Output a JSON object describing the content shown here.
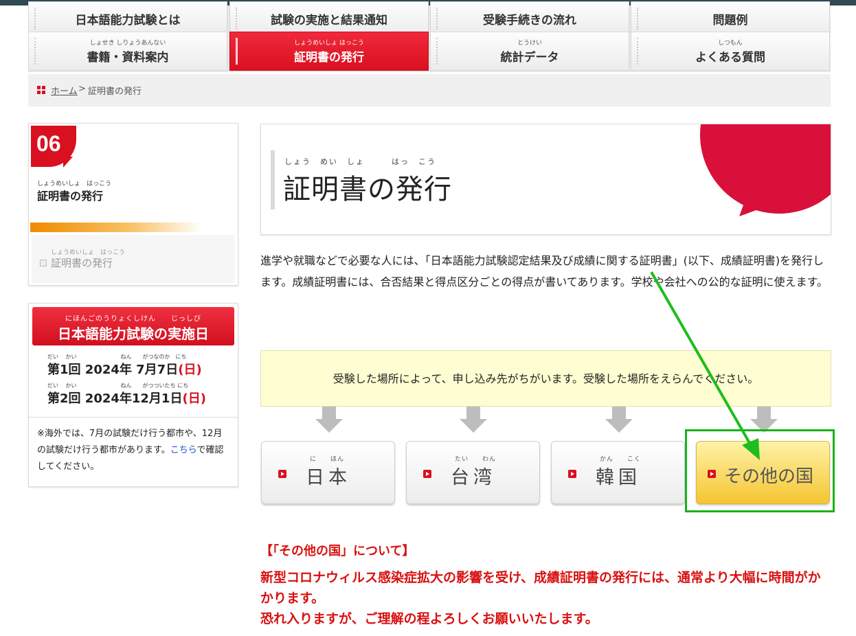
{
  "nav": {
    "row1": [
      {
        "label": "日本語能力試験とは"
      },
      {
        "label": "試験の実施と結果通知"
      },
      {
        "label": "受験手続きの流れ"
      },
      {
        "label": "問題例"
      }
    ],
    "row2": [
      {
        "ruby": "しょせき しりょうあんない",
        "label": "書籍・資料案内"
      },
      {
        "ruby": "しょうめいしょ はっこう",
        "label": "証明書の発行"
      },
      {
        "ruby": "とうけい",
        "label": "統計データ"
      },
      {
        "ruby": "しつもん",
        "label": "よくある質問"
      }
    ]
  },
  "breadcrumb": {
    "home": "ホーム",
    "separator": " > ",
    "current": "証明書の発行"
  },
  "sidebar": {
    "number": "06",
    "ruby": "しょうめいしょ　はっこう",
    "title": "証明書の発行",
    "sub_ruby": "しょうめいしょ　はっこう",
    "sub_link": "証明書の発行"
  },
  "schedule": {
    "ruby": "にほんごのうりょくしけん　　じっしび",
    "title": "日本語能力試験の実施日",
    "row1_ruby": "だい　 かい　　　　　　　　ねん　　がつなのか　にち",
    "row1": "第1回 2024年 7月7日",
    "row1_day": "(日)",
    "row2_ruby": "だい　 かい　　　　　　　　ねん　　がつついたち にち",
    "row2": "第2回 2024年12月1日",
    "row2_day": "(日)",
    "note_a": "※海外では、7月の試験だけ行う都市や、12月の試験だけ行う都市があります。",
    "note_link": "こちら",
    "note_b": "で確認してください。"
  },
  "page": {
    "title_ruby": "しょう　めい　しょ　　　はっ　こう",
    "title": "証明書の発行",
    "intro": "進学や就職などで必要な人には、「日本語能力試験認定結果及び成績に関する証明書」(以下、成績証明書)を発行します。成績証明書には、合否結果と得点区分ごとの得点が書いてあります。学校や会社への公的な証明に使えます。",
    "notice": "受験した場所によって、申し込み先がちがいます。受験した場所をえらんでください。"
  },
  "regions": [
    {
      "ruby": "に　　ほん",
      "label": "日本"
    },
    {
      "ruby": "たい　　わん",
      "label": "台湾"
    },
    {
      "ruby": "かん　　こく",
      "label": "韓国"
    },
    {
      "ruby": "",
      "label": "その他の国"
    }
  ],
  "about": {
    "heading": "【「その他の国」について】",
    "line1": "新型コロナウィルス感染症拡大の影響を受け、成績証明書の発行には、通常より大幅に時間がかかります。",
    "line2": "恐れ入りますが、ご理解の程よろしくお願いいたします。"
  },
  "colors": {
    "brand_red": "#d9101f",
    "highlight_green": "#17b317",
    "notice_bg": "#fffed2"
  }
}
